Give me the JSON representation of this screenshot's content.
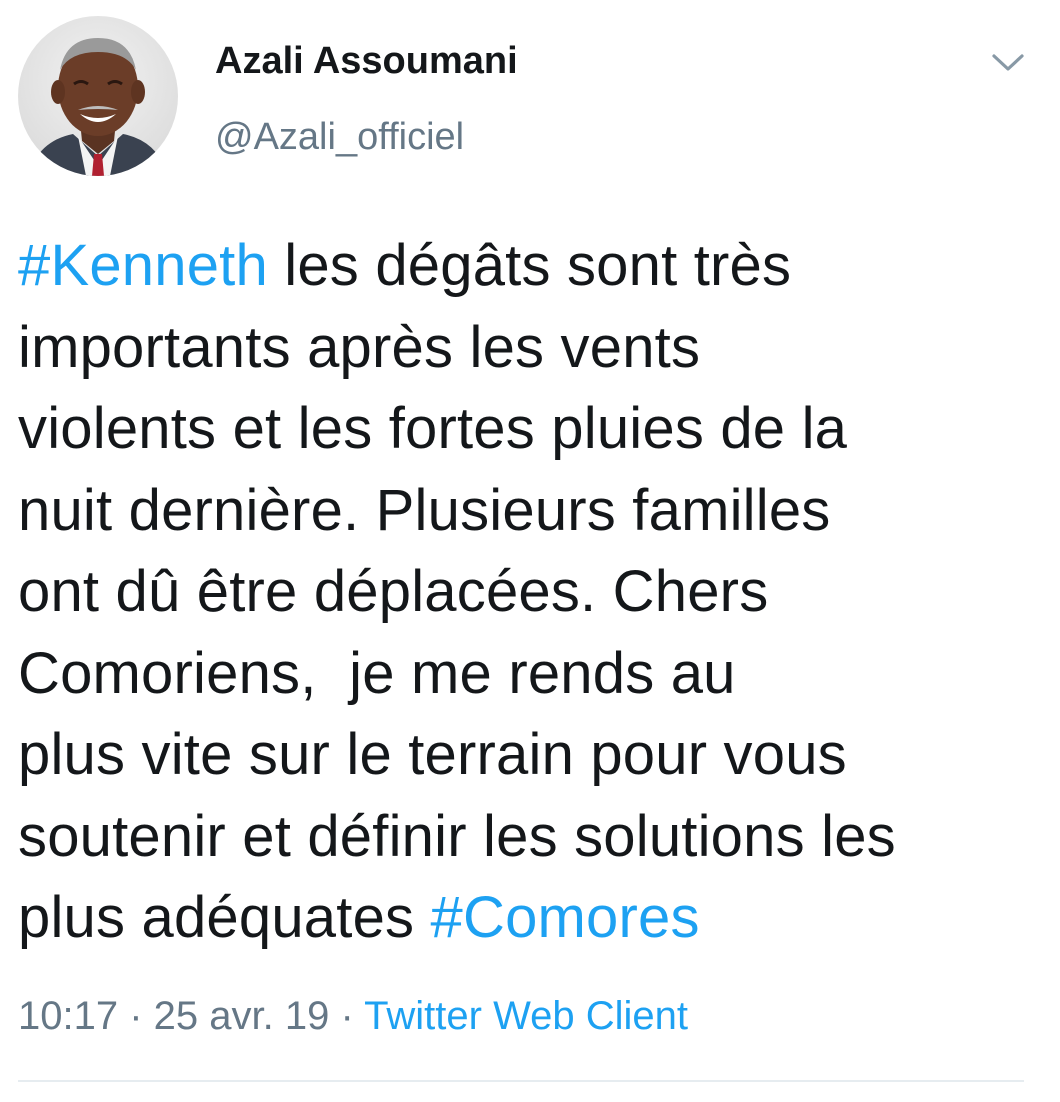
{
  "author": {
    "name": "Azali Assoumani",
    "handle": "@Azali_officiel",
    "avatar_icon": "profile-photo"
  },
  "menu_icon": "chevron-down-icon",
  "tweet": {
    "lines": [
      [
        {
          "text": "#Kenneth",
          "hashtag": true
        },
        {
          "text": " les dégâts sont très",
          "hashtag": false
        }
      ],
      [
        {
          "text": "importants après les vents",
          "hashtag": false
        }
      ],
      [
        {
          "text": "violents et les fortes pluies de la",
          "hashtag": false
        }
      ],
      [
        {
          "text": "nuit dernière. Plusieurs familles",
          "hashtag": false
        }
      ],
      [
        {
          "text": "ont dû être déplacées. Chers",
          "hashtag": false
        }
      ],
      [
        {
          "text": "Comoriens,  je me rends au",
          "hashtag": false
        }
      ],
      [
        {
          "text": "plus vite sur le terrain pour vous",
          "hashtag": false
        }
      ],
      [
        {
          "text": "soutenir et définir les solutions les",
          "hashtag": false
        }
      ],
      [
        {
          "text": "plus adéquates ",
          "hashtag": false
        },
        {
          "text": "#Comores",
          "hashtag": true
        }
      ]
    ]
  },
  "meta": {
    "time": "10:17",
    "separator": " · ",
    "date": "25 avr. 19",
    "client": "Twitter Web Client"
  },
  "colors": {
    "text": "#14171a",
    "secondary": "#657786",
    "link": "#1da1f2",
    "divider": "#e6ecf0"
  }
}
